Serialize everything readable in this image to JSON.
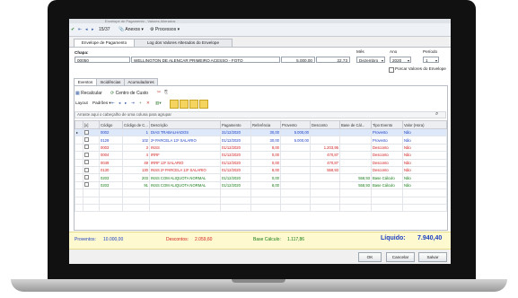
{
  "window": {
    "title": "Envelope de Pagamento - Valores Alterados"
  },
  "toolbar": {
    "position": "15/37",
    "annexes": "Anexos",
    "processes": "Processos"
  },
  "tabs": {
    "envelope": "Envelope de Pagamento",
    "log": "Log dos Valores Alterados do Envelope"
  },
  "header": {
    "chapa_label": "Chapa:",
    "chapa": "00050",
    "name": "WELLINGTON DE ALENCAR PRIMEIRO ACESSO - FOTO",
    "salary": "5.000,00",
    "hours": "22,73",
    "month_label": "Mês",
    "month": "Dezembro",
    "year_label": "Ano",
    "year": "2020",
    "period_label": "Período",
    "period": "1",
    "check_label": "Porcar Valores do Envelope"
  },
  "subtabs": {
    "events": "Eventos",
    "incidences": "Incidências",
    "accumulators": "Acumuladores"
  },
  "actions": {
    "recalc": "Recalcular",
    "cost_center": "Centro de Custo",
    "layout": "Layout",
    "patterns": "Padrões"
  },
  "group_hint": "Arraste aqui o cabeçalho de uma coluna para agrupar",
  "columns": [
    "[x]",
    "Código",
    "Código de C...",
    "Descrição",
    "Pagamento",
    "Referência",
    "Provento",
    "Desconto",
    "Base de Cál...",
    "Tipo Evento",
    "Valor (Hora)"
  ],
  "rows": [
    {
      "code": "0002",
      "cc": "1",
      "desc": "DIAS TRABALHADOS",
      "pay": "31/12/2020",
      "ref": "30,00",
      "prov": "5.000,00",
      "desc_val": "",
      "base": "",
      "type": "Provento",
      "val": "Não",
      "color": "#1b3fc4",
      "selected": true
    },
    {
      "code": "0129",
      "cc": "102",
      "desc": "2ª PARCELA 13º SALARIO",
      "pay": "01/12/2020",
      "ref": "30,00",
      "prov": "5.000,00",
      "desc_val": "",
      "base": "",
      "type": "Provento",
      "val": "Não",
      "color": "#1b3fc4",
      "selected": false
    },
    {
      "code": "0003",
      "cc": "3",
      "desc": "INSS",
      "pay": "01/12/2020",
      "ref": "8,00",
      "prov": "",
      "desc_val": "1.203,95",
      "base": "",
      "type": "Desconto",
      "val": "Não",
      "color": "#d11b1b",
      "selected": false
    },
    {
      "code": "0004",
      "cc": "4",
      "desc": "IRRF",
      "pay": "01/12/2020",
      "ref": "0,00",
      "prov": "",
      "desc_val": "470,87",
      "base": "",
      "type": "Desconto",
      "val": "Não",
      "color": "#d11b1b",
      "selected": false
    },
    {
      "code": "0049",
      "cc": "49",
      "desc": "IRRF 13º SALARIO",
      "pay": "01/12/2020",
      "ref": "0,00",
      "prov": "",
      "desc_val": "470,87",
      "base": "",
      "type": "Desconto",
      "val": "Não",
      "color": "#d11b1b",
      "selected": false
    },
    {
      "code": "0130",
      "cc": "130",
      "desc": "INSS 2ª PARCELA 13º SALARIO",
      "pay": "01/12/2020",
      "ref": "8,00",
      "prov": "",
      "desc_val": "558,93",
      "base": "",
      "type": "Desconto",
      "val": "Não",
      "color": "#d11b1b",
      "selected": false
    },
    {
      "code": "0203",
      "cc": "203",
      "desc": "INSS COM ALIQUOTA NORMAL",
      "pay": "01/12/2020",
      "ref": "0,00",
      "prov": "",
      "desc_val": "",
      "base": "558,93",
      "type": "Base Cálculo",
      "val": "Não",
      "color": "#147a14",
      "selected": false
    },
    {
      "code": "0203",
      "cc": "91",
      "desc": "INSS COM ALIQUOTA NORMAL",
      "pay": "01/12/2020",
      "ref": "8,00",
      "prov": "",
      "desc_val": "",
      "base": "558,93",
      "type": "Base Cálculo",
      "val": "Não",
      "color": "#147a14",
      "selected": false
    }
  ],
  "totals": {
    "prov_label": "Proventos:",
    "prov": "10.000,00",
    "desc_label": "Descontos:",
    "desc": "2.059,60",
    "base_label": "Base Cálculo:",
    "base": "1.117,86",
    "net_label": "Líquido:",
    "net": "7.940,40"
  },
  "buttons": {
    "ok": "OK",
    "cancel": "Cancelar",
    "save": "Salvar"
  },
  "colors": {
    "proventos": "#1b3fc4",
    "descontos": "#d11b1b",
    "base": "#147a14"
  }
}
